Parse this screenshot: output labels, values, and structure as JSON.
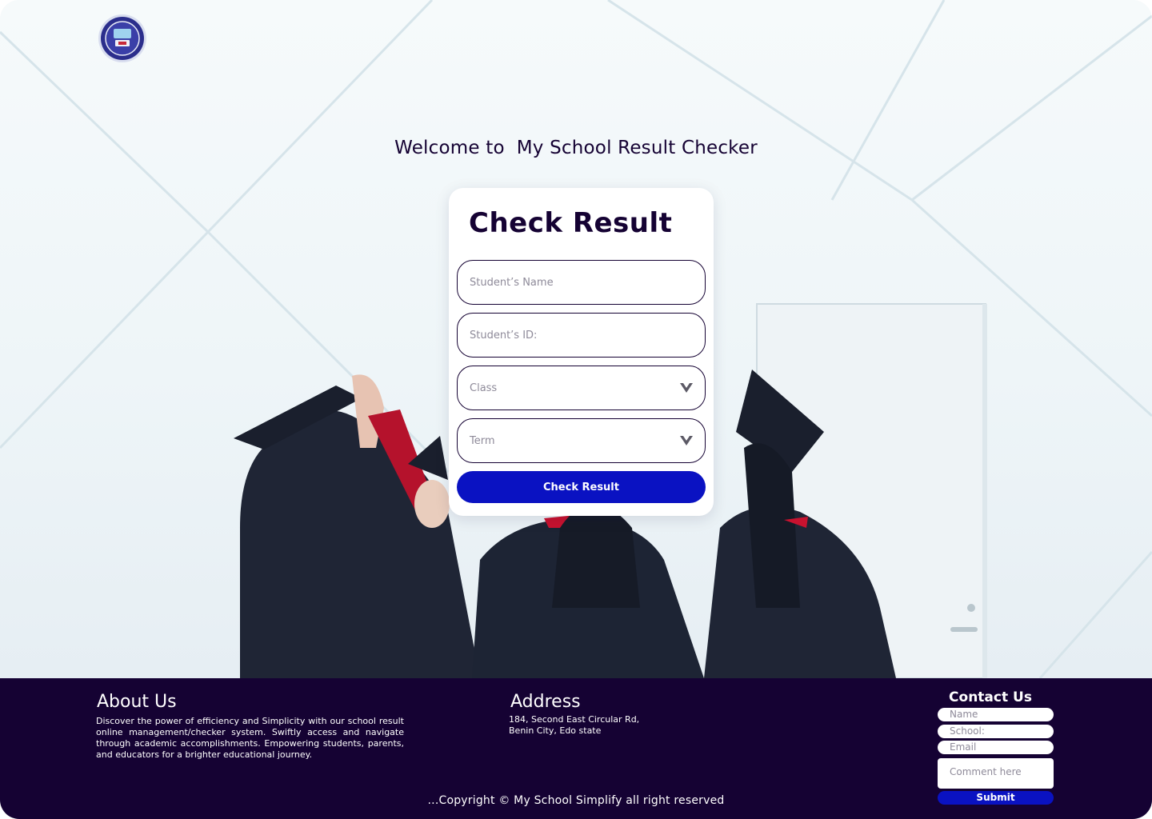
{
  "header": {
    "logo_icon": "school-crest-logo-icon"
  },
  "hero": {
    "welcome": "Welcome to  My School Result Checker",
    "background": "graduates-photo"
  },
  "form": {
    "title": "Check Result",
    "student_name_placeholder": "Student’s Name",
    "student_id_placeholder": "Student’s ID:",
    "class_placeholder": "Class",
    "term_placeholder": "Term",
    "dropdown_icon": "chevron-down-icon",
    "submit_label": "Check Result"
  },
  "footer": {
    "about": {
      "heading": "About Us",
      "text": "Discover the power of efficiency and Simplicity with our school result online management/checker system. Swiftly access and navigate through academic accomplishments. Empowering students, parents, and educators for a brighter educational journey."
    },
    "address": {
      "heading": "Address",
      "line1": "184, Second East Circular Rd,",
      "line2": "Benin City, Edo state"
    },
    "contact": {
      "heading": "Contact Us",
      "name_placeholder": "Name",
      "school_placeholder": "School:",
      "email_placeholder": "Email",
      "comment_placeholder": "Comment here",
      "submit_label": "Submit"
    },
    "copyright": "...Copyright © My School Simplify all right reserved"
  },
  "colors": {
    "navy": "#150233",
    "primary_blue": "#0a12c2",
    "white": "#ffffff"
  }
}
